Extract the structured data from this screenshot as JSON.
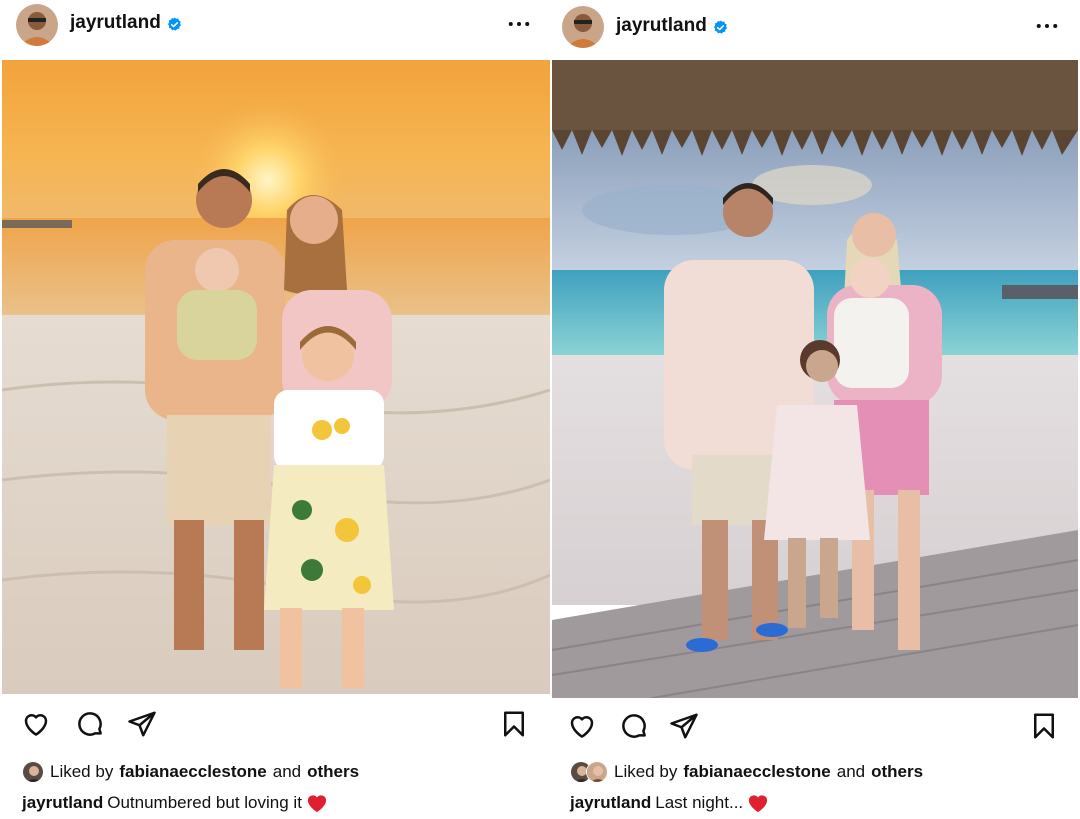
{
  "posts": [
    {
      "username": "jayrutland",
      "liked_prefix": "Liked by",
      "liked_user": "fabianaecclestone",
      "liked_and": "and",
      "liked_others": "others",
      "caption_user": "jayrutland",
      "caption_text": "Outnumbered but loving it",
      "caption_emoji": "red-heart",
      "photo_alt": "beach-sunset-family-photo"
    },
    {
      "username": "jayrutland",
      "liked_prefix": "Liked by",
      "liked_user": "fabianaecclestone",
      "liked_and": "and",
      "liked_others": "others",
      "caption_user": "jayrutland",
      "caption_text": "Last night...",
      "caption_emoji": "red-heart",
      "photo_alt": "beach-hut-family-photo"
    }
  ],
  "icons": {
    "verified": "verified-badge-icon",
    "more": "more-options-icon",
    "like": "heart-icon",
    "comment": "comment-icon",
    "share": "send-icon",
    "save": "bookmark-icon"
  },
  "colors": {
    "verified_blue": "#0095f6",
    "heart_red": "#e0202f",
    "text": "#111111"
  }
}
